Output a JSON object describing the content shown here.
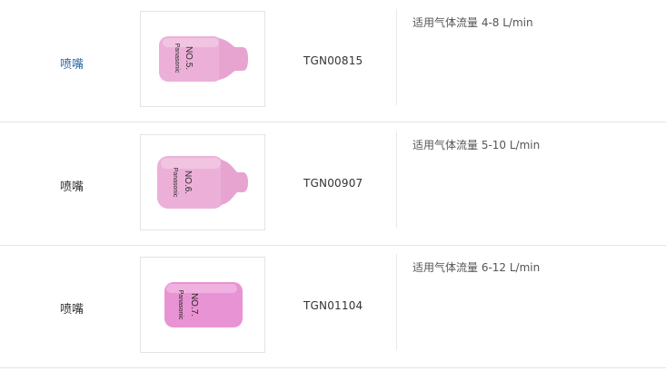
{
  "rows": [
    {
      "name": "喷嘴",
      "code": "TGN00815",
      "description": "适用气体流量 4-8 L/min",
      "nozzle_text": [
        "Panasonic",
        "NO.5."
      ],
      "nozzle_color": "#ecb0d8"
    },
    {
      "name": "喷嘴",
      "code": "TGN00907",
      "description": "适用气体流量 5-10 L/min",
      "nozzle_text": [
        "Panasonic",
        "NO.6."
      ],
      "nozzle_color": "#ecb0d8"
    },
    {
      "name": "喷嘴",
      "code": "TGN01104",
      "description": "适用气体流量 6-12 L/min",
      "nozzle_text": [
        "Panasonic",
        "NO.7."
      ],
      "nozzle_color": "#e893d4"
    }
  ],
  "colors": {
    "link": "#2f6aa7",
    "border": "#e3e3e3"
  }
}
